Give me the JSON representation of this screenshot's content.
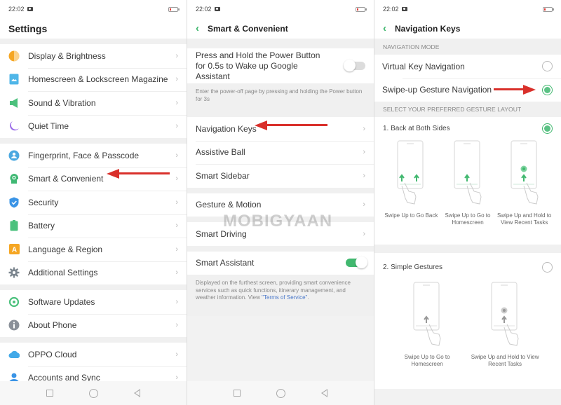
{
  "status": {
    "time": "22:02"
  },
  "screen1": {
    "title": "Settings",
    "groups": [
      [
        {
          "label": "Display & Brightness",
          "icon": "brightness-icon"
        },
        {
          "label": "Homescreen & Lockscreen Magazine",
          "icon": "wallpaper-icon"
        },
        {
          "label": "Sound & Vibration",
          "icon": "speaker-icon"
        },
        {
          "label": "Quiet Time",
          "icon": "moon-icon"
        }
      ],
      [
        {
          "label": "Fingerprint, Face & Passcode",
          "icon": "fingerprint-icon"
        },
        {
          "label": "Smart & Convenient",
          "icon": "smart-head-icon"
        },
        {
          "label": "Security",
          "icon": "shield-icon"
        },
        {
          "label": "Battery",
          "icon": "battery-icon"
        },
        {
          "label": "Language & Region",
          "icon": "language-icon"
        },
        {
          "label": "Additional Settings",
          "icon": "gear-icon"
        }
      ],
      [
        {
          "label": "Software Updates",
          "icon": "update-icon"
        },
        {
          "label": "About Phone",
          "icon": "info-icon"
        }
      ],
      [
        {
          "label": "OPPO Cloud",
          "icon": "cloud-icon"
        },
        {
          "label": "Accounts and Sync",
          "icon": "person-icon"
        }
      ]
    ]
  },
  "screen2": {
    "title": "Smart & Convenient",
    "power_button": {
      "label": "Press and Hold the Power Button for 0.5s to Wake up Google Assistant",
      "enabled": false,
      "note": "Enter the power-off page by pressing and holding the Power button for 3s"
    },
    "group1": [
      "Navigation Keys",
      "Assistive Ball",
      "Smart Sidebar"
    ],
    "group2": [
      "Gesture & Motion"
    ],
    "group3": [
      "Smart Driving"
    ],
    "smart_assistant": {
      "label": "Smart Assistant",
      "enabled": true,
      "note": "Displayed on the furthest screen, providing smart convenience services such as quick functions, itinerary management, and weather information. View ",
      "link": "\"Terms of Service\"",
      "note_end": "."
    }
  },
  "screen3": {
    "title": "Navigation Keys",
    "mode_header": "NAVIGATION MODE",
    "modes": [
      {
        "label": "Virtual Key Navigation",
        "selected": false
      },
      {
        "label": "Swipe-up Gesture Navigation",
        "selected": true
      }
    ],
    "layout_header": "SELECT YOUR PREFERRED GESTURE LAYOUT",
    "layouts": [
      {
        "title": "1. Back at Both Sides",
        "selected": true,
        "illustrations": [
          {
            "caption": "Swipe Up to Go Back"
          },
          {
            "caption": "Swipe Up to Go to Homescreen"
          },
          {
            "caption": "Swipe Up and Hold to View Recent Tasks"
          }
        ]
      },
      {
        "title": "2. Simple Gestures",
        "selected": false,
        "illustrations": [
          {
            "caption": "Swipe Up to Go to Homescreen"
          },
          {
            "caption": "Swipe Up and Hold to View Recent Tasks"
          }
        ]
      }
    ]
  },
  "watermark": "MOBIGYAAN",
  "colors": {
    "accent_green": "#41b86f",
    "annotation_red": "#d9302b",
    "link_blue": "#4a78c9"
  }
}
